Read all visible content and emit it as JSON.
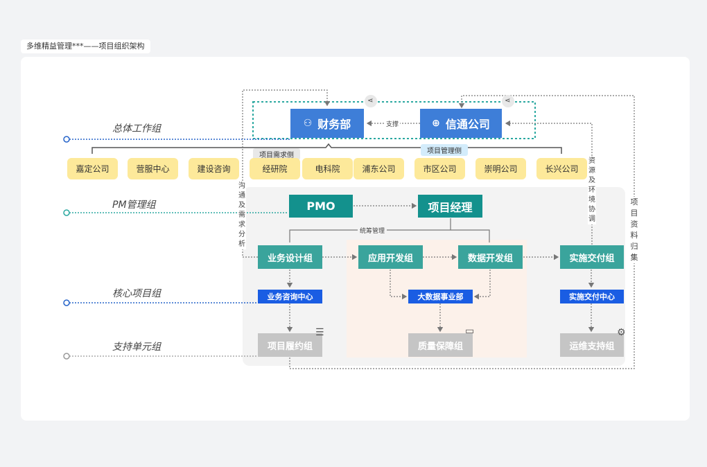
{
  "title": "多维精益管理***——项目组织架构",
  "tiers": [
    "总体工作组",
    "PM管理组",
    "核心项目组",
    "支持单元组"
  ],
  "top": {
    "finance": "财务部",
    "xintong": "信通公司",
    "support_label": "支撑",
    "demand_side": "项目需求侧",
    "manage_side": "项目管理侧"
  },
  "companies": [
    "嘉定公司",
    "营服中心",
    "建设咨询",
    "经研院",
    "电科院",
    "浦东公司",
    "市区公司",
    "崇明公司",
    "长兴公司"
  ],
  "pm": {
    "pmo": "PMO",
    "manager": "项目经理",
    "coord": "统筹管理"
  },
  "core": {
    "design": "业务设计组",
    "app_dev": "应用开发组",
    "data_dev": "数据开发组",
    "delivery": "实施交付组",
    "consult_center": "业务咨询中心",
    "bigdata": "大数据事业部",
    "delivery_center": "实施交付中心"
  },
  "support": {
    "perform": "项目履约组",
    "quality": "质量保障组",
    "ops": "运维支持组"
  },
  "side_notes": {
    "comm": "沟通及需求分析",
    "resource": "资源及环境协调",
    "collect": "项目资料归集"
  },
  "colors": {
    "blue": "#3e7ed8",
    "teal": "#3aa49c",
    "yellow": "#fde99a",
    "bright_blue": "#1a5de3"
  }
}
